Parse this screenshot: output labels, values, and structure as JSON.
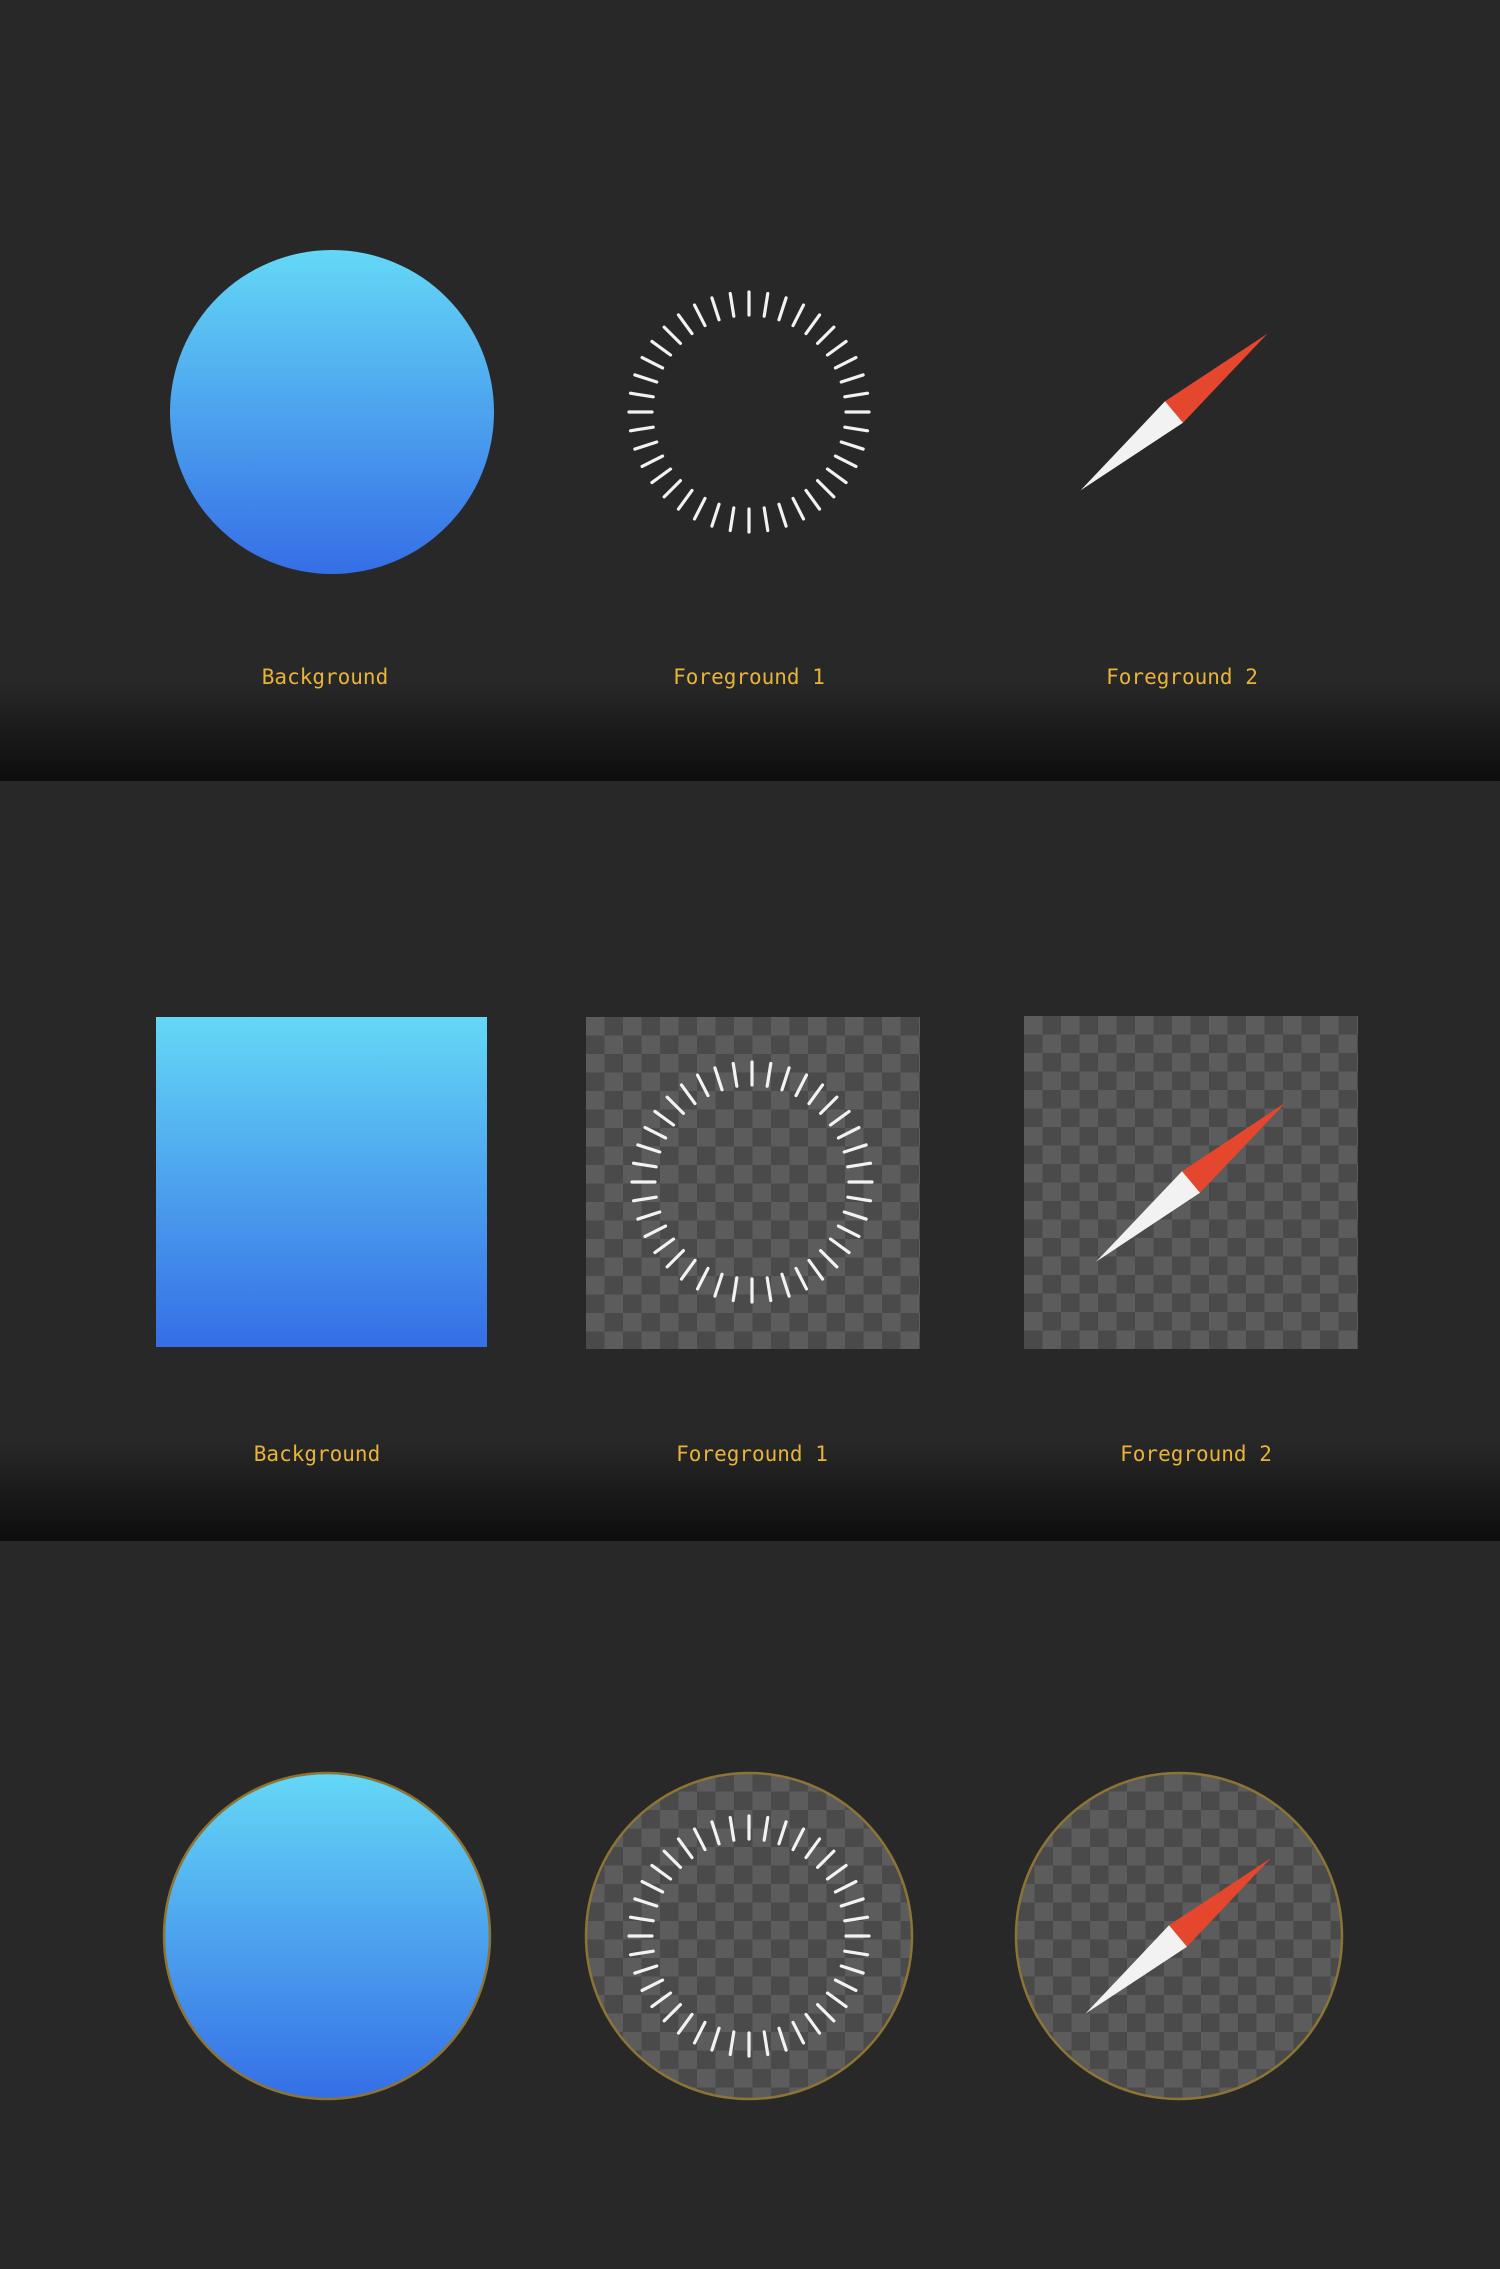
{
  "colors": {
    "background": "#282828",
    "label": "#e8b339",
    "gradient_top": "#64d8f6",
    "gradient_bottom": "#356ee6",
    "needle_red": "#e5472e",
    "needle_white": "#f2f2f2",
    "mask_outline": "#8c7434",
    "checker_light": "#5c5c5c",
    "checker_dark": "#4a4a4a",
    "tick": "#f2f2f2"
  },
  "tick_count": 40,
  "needle_angle_deg": 40,
  "sections": [
    {
      "labels": [
        "Background",
        "Foreground 1",
        "Foreground 2"
      ]
    },
    {
      "labels": [
        "Background",
        "Foreground 1",
        "Foreground 2"
      ]
    }
  ]
}
